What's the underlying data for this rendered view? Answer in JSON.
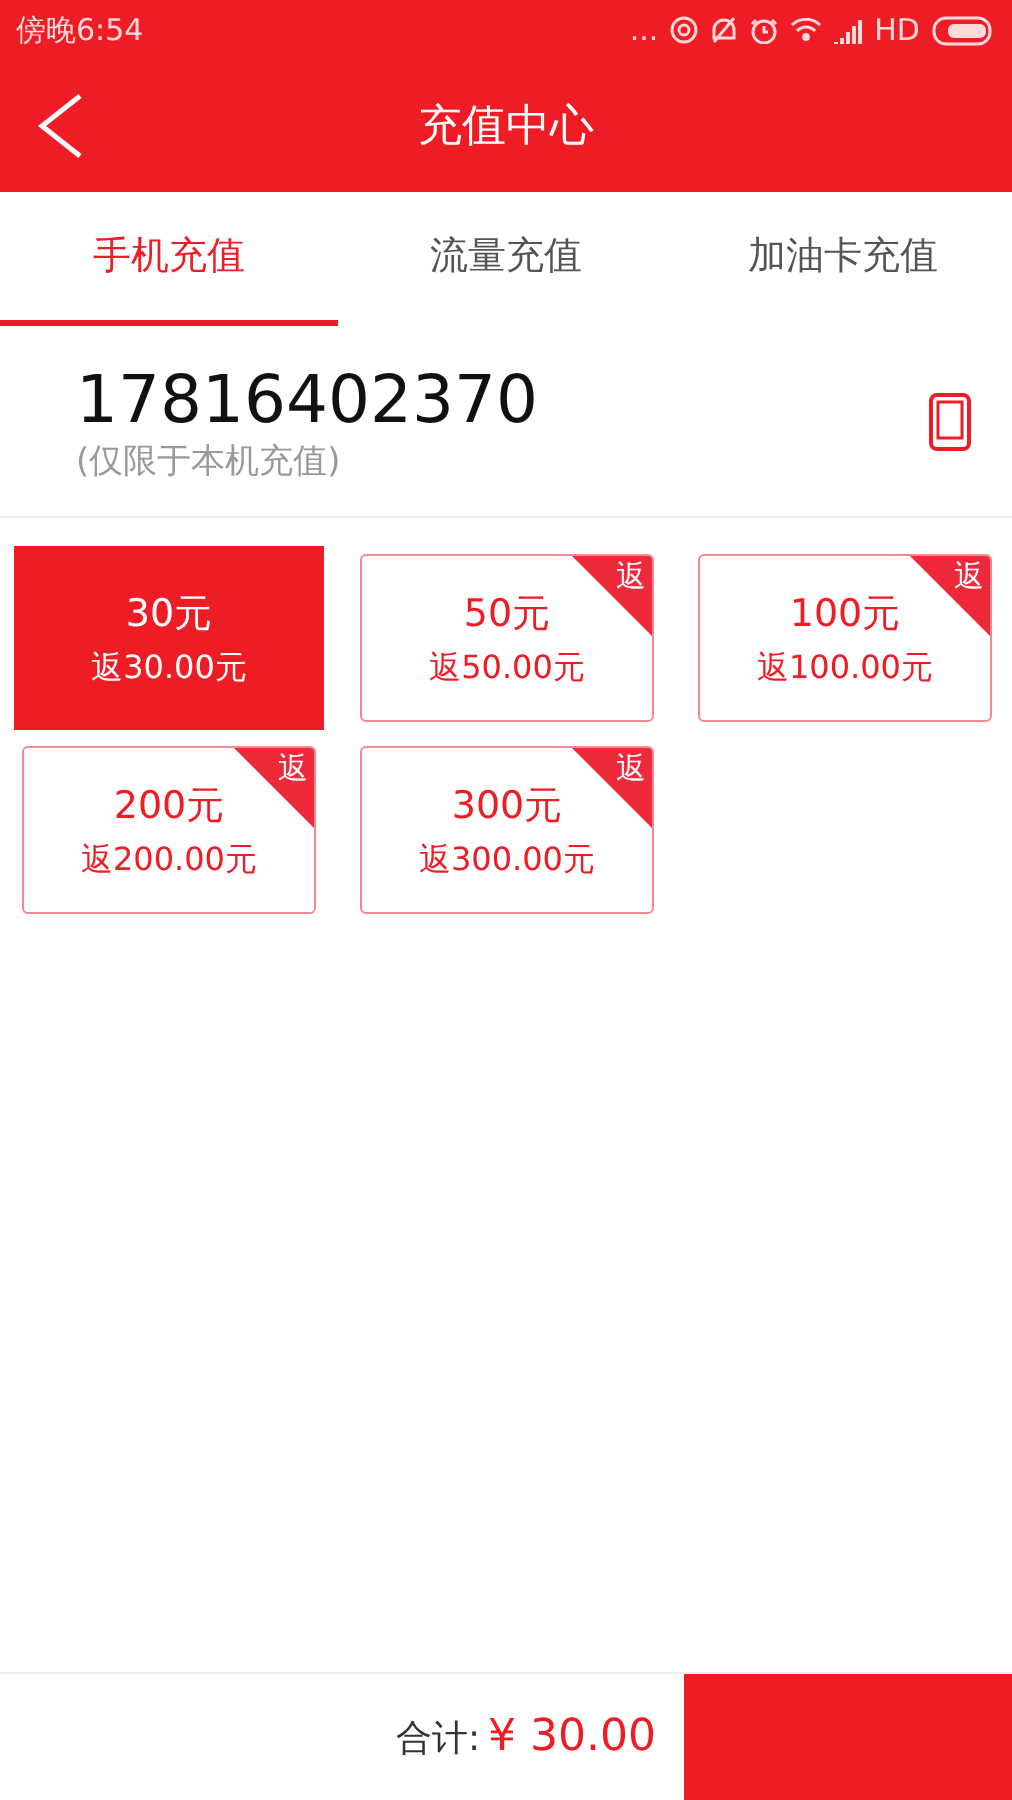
{
  "status_bar": {
    "time": "傍晚6:54",
    "more": "...",
    "network": "HD"
  },
  "header": {
    "title": "充值中心"
  },
  "tabs": [
    {
      "label": "手机充值",
      "selected": true
    },
    {
      "label": "流量充值",
      "selected": false
    },
    {
      "label": "加油卡充值",
      "selected": false
    }
  ],
  "phone": {
    "number": "17816402370",
    "note": "(仅限于本机充值)"
  },
  "options": [
    {
      "amount": "30元",
      "rebate": "返30.00元",
      "selected": true
    },
    {
      "amount": "50元",
      "rebate": "返50.00元",
      "tag": "返",
      "selected": false
    },
    {
      "amount": "100元",
      "rebate": "返100.00元",
      "tag": "返",
      "selected": false
    },
    {
      "amount": "200元",
      "rebate": "返200.00元",
      "tag": "返",
      "selected": false
    },
    {
      "amount": "300元",
      "rebate": "返300.00元",
      "tag": "返",
      "selected": false
    }
  ],
  "footer": {
    "total_label": "合计:",
    "total": "¥ 30.00"
  }
}
